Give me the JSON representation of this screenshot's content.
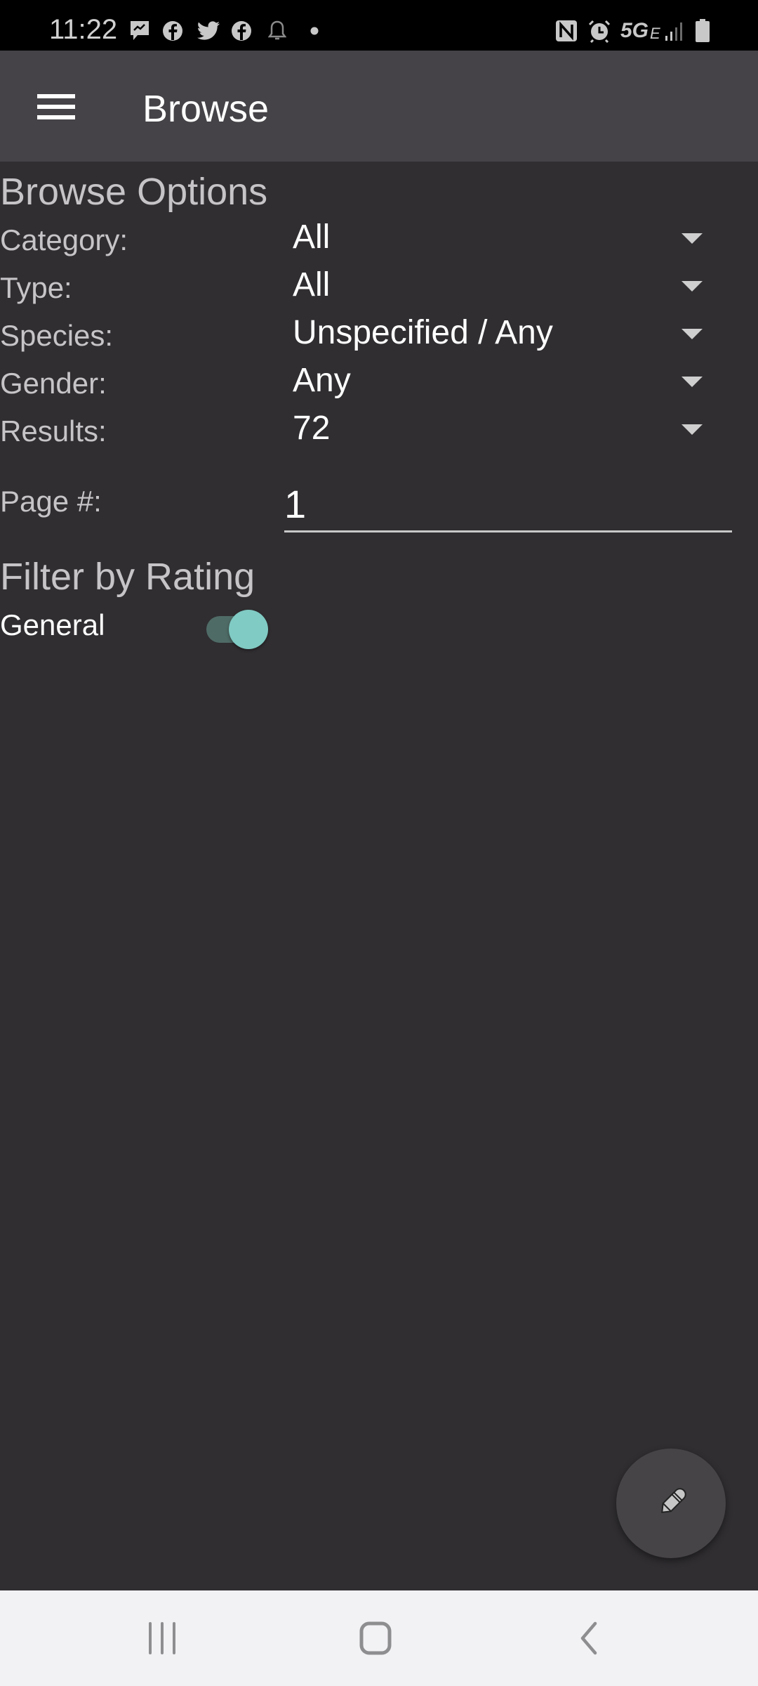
{
  "status_bar": {
    "time": "11:22",
    "notification_icons": [
      "messenger-icon",
      "facebook-icon",
      "twitter-icon",
      "facebook-icon",
      "bell-icon",
      "dot-icon"
    ],
    "system_icons": [
      "nfc-icon",
      "alarm-icon",
      "network-5ge-icon",
      "signal-icon",
      "battery-icon"
    ],
    "network_label": "5G",
    "network_sub": "E"
  },
  "app_bar": {
    "title": "Browse",
    "menu_icon": "hamburger-menu-icon"
  },
  "browse_options": {
    "title": "Browse Options",
    "fields": [
      {
        "label": "Category:",
        "value": "All"
      },
      {
        "label": "Type:",
        "value": "All"
      },
      {
        "label": "Species:",
        "value": "Unspecified / Any"
      },
      {
        "label": "Gender:",
        "value": "Any"
      },
      {
        "label": "Results:",
        "value": "72"
      }
    ],
    "page": {
      "label": "Page #:",
      "value": "1"
    }
  },
  "filter_by_rating": {
    "title": "Filter by Rating",
    "items": [
      {
        "label": "General",
        "enabled": true
      }
    ]
  },
  "fab": {
    "icon": "pencil-icon"
  },
  "colors": {
    "accent": "#80cbc4",
    "background": "#302e31",
    "app_bar": "#454347"
  },
  "nav_bar": {
    "buttons": [
      "recent-apps-icon",
      "home-icon",
      "back-icon"
    ]
  }
}
